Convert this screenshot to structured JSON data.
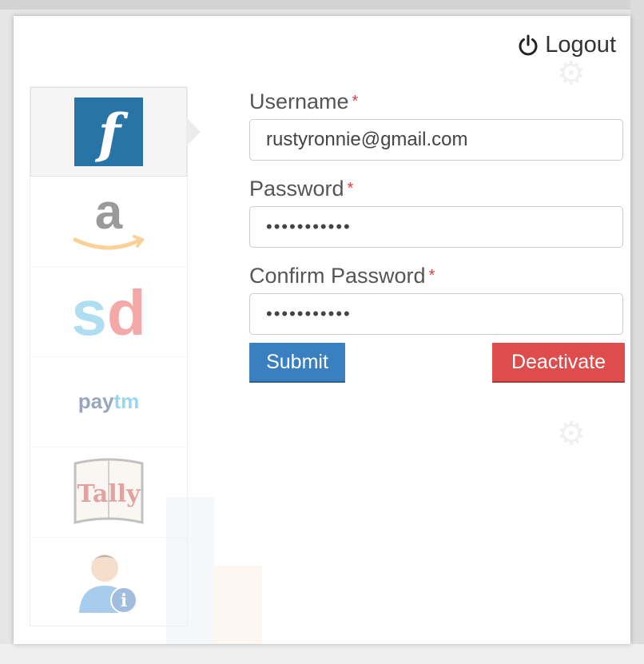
{
  "header": {
    "logout_label": "Logout"
  },
  "sidebar": {
    "items": [
      {
        "name": "flipkart",
        "logo_text": "f",
        "active": true
      },
      {
        "name": "amazon",
        "logo_text": "a",
        "active": false
      },
      {
        "name": "snapdeal",
        "logo_text": "sd",
        "active": false
      },
      {
        "name": "paytm",
        "logo_text": "paytm",
        "active": false
      },
      {
        "name": "tally",
        "logo_text": "Tally",
        "active": false
      },
      {
        "name": "user-info",
        "logo_text": "",
        "active": false
      }
    ]
  },
  "form": {
    "username": {
      "label": "Username",
      "required_mark": "*",
      "value": "rustyronnie@gmail.com"
    },
    "password": {
      "label": "Password",
      "required_mark": "*",
      "value": "•••••••••••"
    },
    "confirm_password": {
      "label": "Confirm Password",
      "required_mark": "*",
      "value": "•••••••••••"
    },
    "submit_label": "Submit",
    "deactivate_label": "Deactivate"
  },
  "colors": {
    "submit": "#3a7fc0",
    "deactivate": "#df4c4c",
    "required": "#e03c3c",
    "flipkart_blue": "#2874a6",
    "amazon_orange": "#f49a1c",
    "snapdeal_blue": "#4fb8e6",
    "snapdeal_red": "#e8423f",
    "paytm_navy": "#1e3a6b",
    "paytm_cyan": "#1aa9e0",
    "tally_red": "#c2302c"
  }
}
